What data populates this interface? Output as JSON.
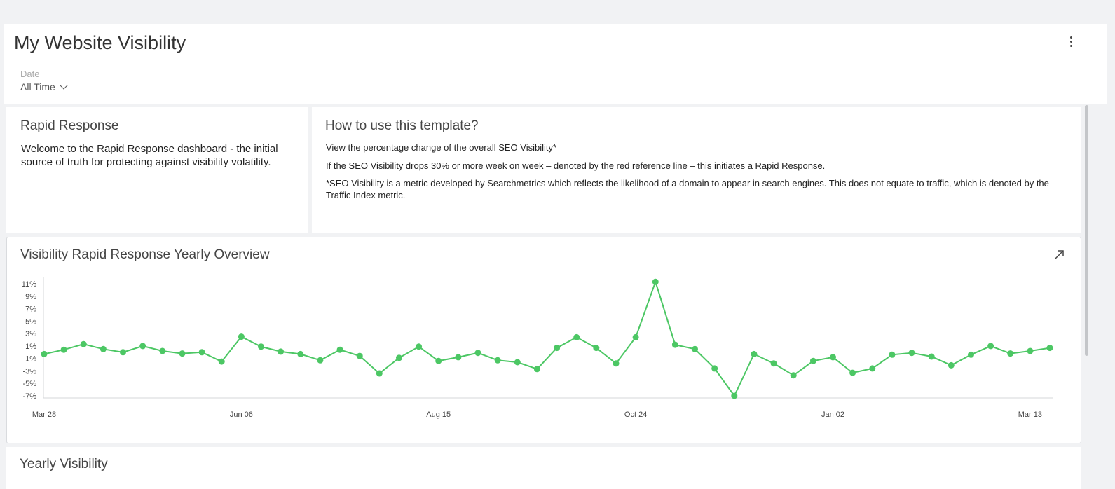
{
  "header": {
    "title": "My Website Visibility",
    "filter_label": "Date",
    "filter_value": "All Time"
  },
  "rapid_response_card": {
    "title": "Rapid Response",
    "body": "Welcome to the Rapid Response dashboard - the initial source of truth for protecting against visibility volatility."
  },
  "how_to_card": {
    "title": "How to use this template?",
    "paragraphs": [
      "View the percentage change of the overall SEO Visibility*",
      "If the SEO Visibility drops 30% or more week on week – denoted by the red reference line – this initiates a Rapid Response.",
      "*SEO Visibility is a metric developed by Searchmetrics which reflects the likelihood of a domain to appear in search engines. This does not equate to traffic, which is denoted by the Traffic Index metric."
    ]
  },
  "chart_card": {
    "title": "Visibility Rapid Response Yearly Overview"
  },
  "yearly_card": {
    "title": "Yearly Visibility"
  },
  "colors": {
    "series": "#4cc764",
    "accent_text": "#333333"
  },
  "icons": {
    "menu": "kebab-menu-icon",
    "expand": "expand-arrow-icon",
    "dropdown": "chevron-down-icon"
  },
  "chart_data": {
    "type": "line",
    "title": "Visibility Rapid Response Yearly Overview",
    "xlabel": "",
    "ylabel": "",
    "ylim": [
      -7,
      11
    ],
    "y_ticks": [
      "11%",
      "9%",
      "7%",
      "5%",
      "3%",
      "1%",
      "-1%",
      "-3%",
      "-5%",
      "-7%"
    ],
    "y_tick_values": [
      11,
      9,
      7,
      5,
      3,
      1,
      -1,
      -3,
      -5,
      -7
    ],
    "x_ticks": [
      "Mar 28",
      "Jun 06",
      "Aug 15",
      "Oct 24",
      "Jan 02",
      "Mar 13"
    ],
    "x_tick_indices": [
      0,
      10,
      20,
      30,
      40,
      50
    ],
    "grid": false,
    "series": [
      {
        "values": [
          -0.3,
          0.4,
          1.3,
          0.5,
          0.0,
          1.0,
          0.2,
          -0.2,
          0.0,
          -1.5,
          2.5,
          0.9,
          0.1,
          -0.3,
          -1.3,
          0.4,
          -0.6,
          -3.4,
          -0.9,
          0.9,
          -1.4,
          -0.8,
          -0.1,
          -1.3,
          -1.6,
          -2.7,
          0.7,
          2.4,
          0.7,
          -1.8,
          2.4,
          11.3,
          1.2,
          0.5,
          -2.6,
          -7.0,
          -0.3,
          -1.8,
          -3.7,
          -1.4,
          -0.8,
          -3.3,
          -2.6,
          -0.4,
          -0.1,
          -0.7,
          -2.1,
          -0.4,
          1.0,
          -0.2,
          0.2,
          0.7
        ]
      }
    ]
  }
}
